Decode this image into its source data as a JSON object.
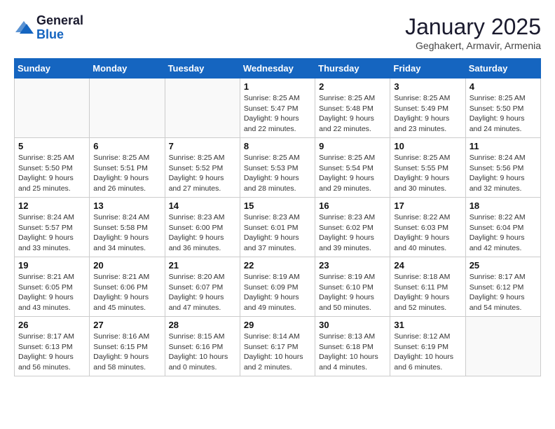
{
  "logo": {
    "general": "General",
    "blue": "Blue"
  },
  "header": {
    "month": "January 2025",
    "location": "Geghakert, Armavir, Armenia"
  },
  "weekdays": [
    "Sunday",
    "Monday",
    "Tuesday",
    "Wednesday",
    "Thursday",
    "Friday",
    "Saturday"
  ],
  "weeks": [
    [
      {
        "day": "",
        "info": ""
      },
      {
        "day": "",
        "info": ""
      },
      {
        "day": "",
        "info": ""
      },
      {
        "day": "1",
        "info": "Sunrise: 8:25 AM\nSunset: 5:47 PM\nDaylight: 9 hours\nand 22 minutes."
      },
      {
        "day": "2",
        "info": "Sunrise: 8:25 AM\nSunset: 5:48 PM\nDaylight: 9 hours\nand 22 minutes."
      },
      {
        "day": "3",
        "info": "Sunrise: 8:25 AM\nSunset: 5:49 PM\nDaylight: 9 hours\nand 23 minutes."
      },
      {
        "day": "4",
        "info": "Sunrise: 8:25 AM\nSunset: 5:50 PM\nDaylight: 9 hours\nand 24 minutes."
      }
    ],
    [
      {
        "day": "5",
        "info": "Sunrise: 8:25 AM\nSunset: 5:50 PM\nDaylight: 9 hours\nand 25 minutes."
      },
      {
        "day": "6",
        "info": "Sunrise: 8:25 AM\nSunset: 5:51 PM\nDaylight: 9 hours\nand 26 minutes."
      },
      {
        "day": "7",
        "info": "Sunrise: 8:25 AM\nSunset: 5:52 PM\nDaylight: 9 hours\nand 27 minutes."
      },
      {
        "day": "8",
        "info": "Sunrise: 8:25 AM\nSunset: 5:53 PM\nDaylight: 9 hours\nand 28 minutes."
      },
      {
        "day": "9",
        "info": "Sunrise: 8:25 AM\nSunset: 5:54 PM\nDaylight: 9 hours\nand 29 minutes."
      },
      {
        "day": "10",
        "info": "Sunrise: 8:25 AM\nSunset: 5:55 PM\nDaylight: 9 hours\nand 30 minutes."
      },
      {
        "day": "11",
        "info": "Sunrise: 8:24 AM\nSunset: 5:56 PM\nDaylight: 9 hours\nand 32 minutes."
      }
    ],
    [
      {
        "day": "12",
        "info": "Sunrise: 8:24 AM\nSunset: 5:57 PM\nDaylight: 9 hours\nand 33 minutes."
      },
      {
        "day": "13",
        "info": "Sunrise: 8:24 AM\nSunset: 5:58 PM\nDaylight: 9 hours\nand 34 minutes."
      },
      {
        "day": "14",
        "info": "Sunrise: 8:23 AM\nSunset: 6:00 PM\nDaylight: 9 hours\nand 36 minutes."
      },
      {
        "day": "15",
        "info": "Sunrise: 8:23 AM\nSunset: 6:01 PM\nDaylight: 9 hours\nand 37 minutes."
      },
      {
        "day": "16",
        "info": "Sunrise: 8:23 AM\nSunset: 6:02 PM\nDaylight: 9 hours\nand 39 minutes."
      },
      {
        "day": "17",
        "info": "Sunrise: 8:22 AM\nSunset: 6:03 PM\nDaylight: 9 hours\nand 40 minutes."
      },
      {
        "day": "18",
        "info": "Sunrise: 8:22 AM\nSunset: 6:04 PM\nDaylight: 9 hours\nand 42 minutes."
      }
    ],
    [
      {
        "day": "19",
        "info": "Sunrise: 8:21 AM\nSunset: 6:05 PM\nDaylight: 9 hours\nand 43 minutes."
      },
      {
        "day": "20",
        "info": "Sunrise: 8:21 AM\nSunset: 6:06 PM\nDaylight: 9 hours\nand 45 minutes."
      },
      {
        "day": "21",
        "info": "Sunrise: 8:20 AM\nSunset: 6:07 PM\nDaylight: 9 hours\nand 47 minutes."
      },
      {
        "day": "22",
        "info": "Sunrise: 8:19 AM\nSunset: 6:09 PM\nDaylight: 9 hours\nand 49 minutes."
      },
      {
        "day": "23",
        "info": "Sunrise: 8:19 AM\nSunset: 6:10 PM\nDaylight: 9 hours\nand 50 minutes."
      },
      {
        "day": "24",
        "info": "Sunrise: 8:18 AM\nSunset: 6:11 PM\nDaylight: 9 hours\nand 52 minutes."
      },
      {
        "day": "25",
        "info": "Sunrise: 8:17 AM\nSunset: 6:12 PM\nDaylight: 9 hours\nand 54 minutes."
      }
    ],
    [
      {
        "day": "26",
        "info": "Sunrise: 8:17 AM\nSunset: 6:13 PM\nDaylight: 9 hours\nand 56 minutes."
      },
      {
        "day": "27",
        "info": "Sunrise: 8:16 AM\nSunset: 6:15 PM\nDaylight: 9 hours\nand 58 minutes."
      },
      {
        "day": "28",
        "info": "Sunrise: 8:15 AM\nSunset: 6:16 PM\nDaylight: 10 hours\nand 0 minutes."
      },
      {
        "day": "29",
        "info": "Sunrise: 8:14 AM\nSunset: 6:17 PM\nDaylight: 10 hours\nand 2 minutes."
      },
      {
        "day": "30",
        "info": "Sunrise: 8:13 AM\nSunset: 6:18 PM\nDaylight: 10 hours\nand 4 minutes."
      },
      {
        "day": "31",
        "info": "Sunrise: 8:12 AM\nSunset: 6:19 PM\nDaylight: 10 hours\nand 6 minutes."
      },
      {
        "day": "",
        "info": ""
      }
    ]
  ]
}
